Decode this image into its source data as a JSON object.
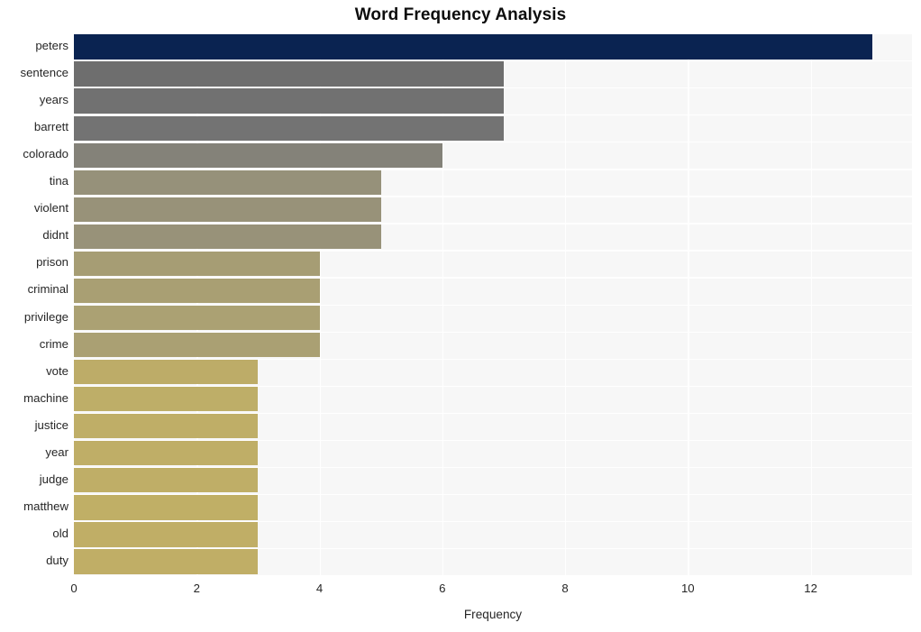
{
  "chart_data": {
    "type": "bar",
    "orientation": "horizontal",
    "title": "Word Frequency Analysis",
    "xlabel": "Frequency",
    "ylabel": "",
    "xlim": [
      0,
      13.65
    ],
    "xticks": [
      "0",
      "2",
      "4",
      "6",
      "8",
      "10",
      "12"
    ],
    "xtick_values": [
      0,
      2,
      4,
      6,
      8,
      10,
      12
    ],
    "grid": true,
    "legend": "none",
    "categories": [
      "peters",
      "sentence",
      "years",
      "barrett",
      "colorado",
      "tina",
      "violent",
      "didnt",
      "prison",
      "criminal",
      "privilege",
      "crime",
      "vote",
      "machine",
      "justice",
      "year",
      "judge",
      "matthew",
      "old",
      "duty"
    ],
    "values": [
      13,
      7,
      7,
      7,
      6,
      5,
      5,
      5,
      4,
      4,
      4,
      4,
      3,
      3,
      3,
      3,
      3,
      3,
      3,
      3
    ],
    "bar_colors": [
      "#0a2351",
      "#6e6e6e",
      "#717171",
      "#737373",
      "#848279",
      "#96917a",
      "#989279",
      "#989279",
      "#a69d74",
      "#a99f73",
      "#aba173",
      "#aaa073",
      "#bdac68",
      "#beae68",
      "#bfae67",
      "#bfae67",
      "#bfae67",
      "#c0af66",
      "#c0ae66",
      "#c0ae66"
    ]
  },
  "figure": {
    "background": "#ffffff",
    "plot_background": "#f7f7f7",
    "gridline_color": "#ffffff",
    "text_color": "#262626",
    "title_color": "#0d0d0d"
  }
}
